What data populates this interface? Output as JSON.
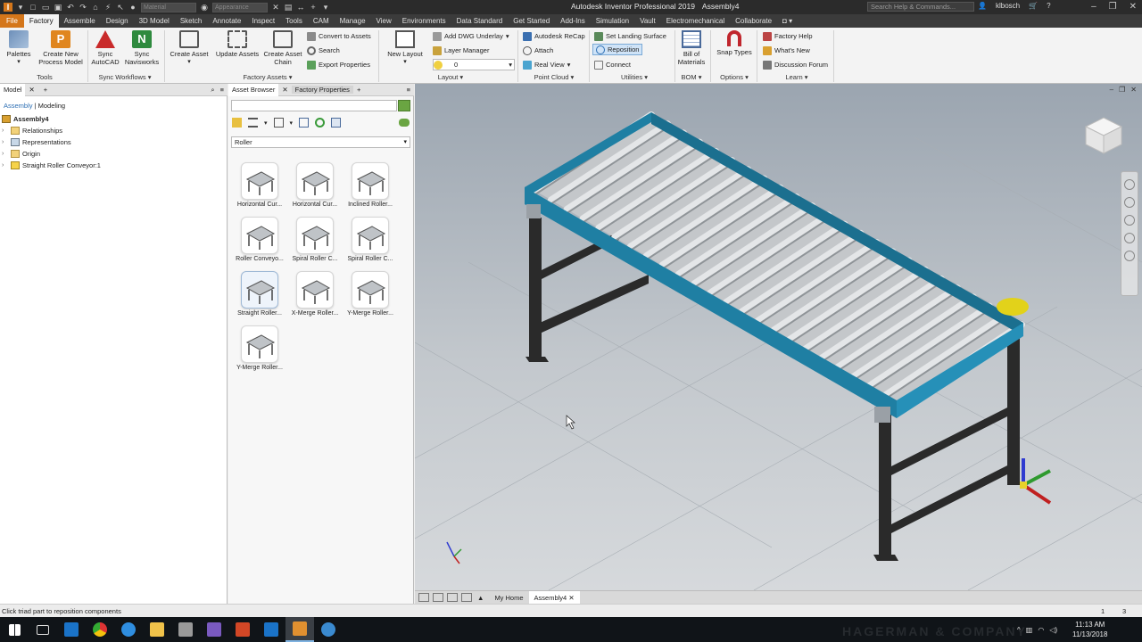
{
  "app": {
    "title": "Autodesk Inventor Professional 2019",
    "document": "Assembly4",
    "qat_material": "Material",
    "qat_appearance": "Appearance",
    "search_placeholder": "Search Help & Commands...",
    "user": "klbosch"
  },
  "ribbon_tabs": [
    "File",
    "Factory",
    "Assemble",
    "Design",
    "3D Model",
    "Sketch",
    "Annotate",
    "Inspect",
    "Tools",
    "CAM",
    "Manage",
    "View",
    "Environments",
    "Data Standard",
    "Get Started",
    "Add-Ins",
    "Simulation",
    "Vault",
    "Electromechanical",
    "Collaborate"
  ],
  "ribbon": {
    "palettes": "Palettes",
    "create_new_process_model": [
      "Create New",
      "Process Model"
    ],
    "tools_group": "Tools",
    "sync_autocad": [
      "Sync",
      "AutoCAD"
    ],
    "sync_navisworks": [
      "Sync",
      "Navisworks"
    ],
    "sync_workflows_group": "Sync Workflows",
    "create_asset": "Create Asset",
    "update_assets": "Update Assets",
    "create_asset_chain": [
      "Create Asset",
      "Chain"
    ],
    "convert_to_assets": "Convert to Assets",
    "search": "Search",
    "export_properties": "Export Properties",
    "factory_assets_group": "Factory Assets",
    "new_layout": "New Layout",
    "add_dwg_underlay": "Add DWG Underlay",
    "layer_manager": "Layer Manager",
    "layer_value": "0",
    "layout_group": "Layout",
    "autodesk_recap": "Autodesk ReCap",
    "attach": "Attach",
    "real_view": "Real View",
    "point_cloud_group": "Point Cloud",
    "set_landing_surface": "Set Landing Surface",
    "reposition": "Reposition",
    "connect": "Connect",
    "utilities_group": "Utilities",
    "bill_of_materials": [
      "Bill of",
      "Materials"
    ],
    "bom_group": "BOM",
    "snap_types": "Snap Types",
    "options_group": "Options",
    "factory_help": "Factory Help",
    "whats_new": "What's New",
    "discussion_forum": "Discussion Forum",
    "learn_group": "Learn"
  },
  "model_panel": {
    "tab_model": "Model",
    "mode_assembly": "Assembly",
    "mode_modeling": "Modeling",
    "tree": [
      "Assembly4",
      "Relationships",
      "Representations",
      "Origin",
      "Straight Roller Conveyor:1"
    ]
  },
  "asset_panel": {
    "tab_asset_browser": "Asset Browser",
    "tab_factory_properties": "Factory Properties",
    "category": "Roller",
    "assets": [
      "Horizontal Cur...",
      "Horizontal Cur...",
      "Inclined Roller...",
      "Roller Conveyo...",
      "Spiral Roller C...",
      "Spiral Roller C...",
      "Straight Roller...",
      "X-Merge Roller...",
      "Y-Merge Roller...",
      "Y-Merge Roller..."
    ]
  },
  "doc_tabs": [
    "My Home",
    "Assembly4"
  ],
  "status": {
    "message": "Click triad part to reposition components",
    "num1": "1",
    "num2": "3"
  },
  "taskbar": {
    "time": "11:13 AM",
    "date": "11/13/2018",
    "watermark": "HAGERMAN & COMPANY"
  },
  "colors": {
    "accent_orange": "#d4761a",
    "conveyor_frame": "#1f7fa3",
    "viewport_top": "#9ba5b0"
  }
}
